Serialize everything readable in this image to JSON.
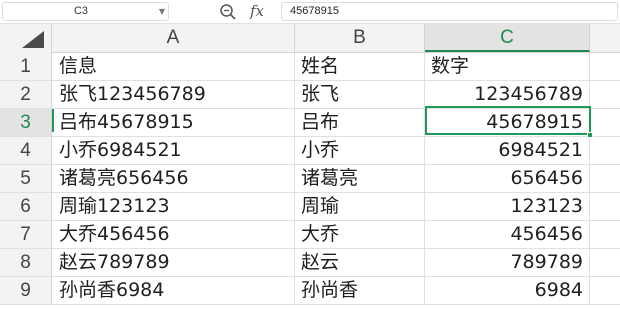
{
  "formula_bar": {
    "name_box": "C3",
    "zoom_icon": "zoom-icon",
    "fx_label": "fx",
    "value": "45678915"
  },
  "columns": [
    "A",
    "B",
    "C"
  ],
  "rows": [
    {
      "num": "1",
      "a": "信息",
      "b": "姓名",
      "c": "数字"
    },
    {
      "num": "2",
      "a": "张飞123456789",
      "b": "张飞",
      "c": "123456789"
    },
    {
      "num": "3",
      "a": "吕布45678915",
      "b": "吕布",
      "c": "45678915"
    },
    {
      "num": "4",
      "a": "小乔6984521",
      "b": "小乔",
      "c": "6984521"
    },
    {
      "num": "5",
      "a": "诸葛亮656456",
      "b": "诸葛亮",
      "c": "656456"
    },
    {
      "num": "6",
      "a": "周瑜123123",
      "b": "周瑜",
      "c": "123123"
    },
    {
      "num": "7",
      "a": "大乔456456",
      "b": "大乔",
      "c": "456456"
    },
    {
      "num": "8",
      "a": "赵云789789",
      "b": "赵云",
      "c": "789789"
    },
    {
      "num": "9",
      "a": "孙尚香6984",
      "b": "孙尚香",
      "c": "6984"
    }
  ],
  "selected_cell": "C3",
  "colors": {
    "selection": "#1f9a55",
    "header_bg": "#f3f3f3"
  }
}
